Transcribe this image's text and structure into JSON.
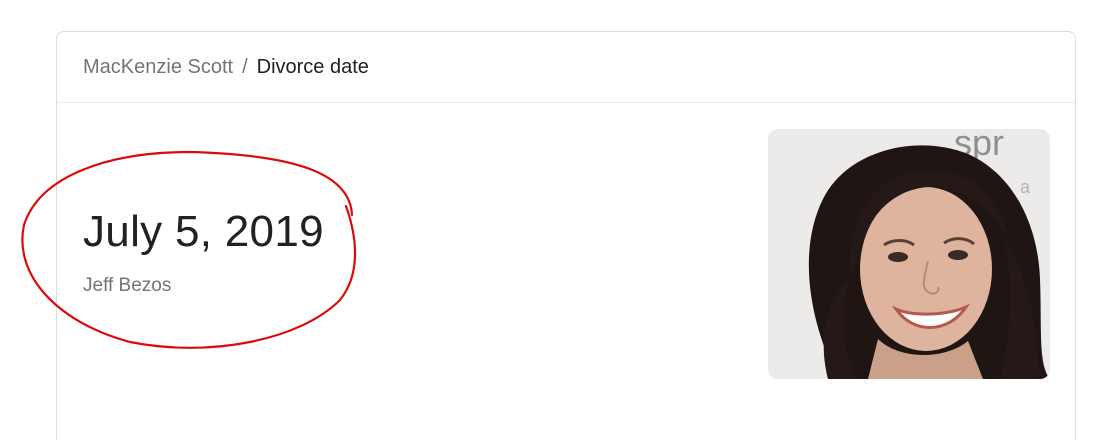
{
  "breadcrumb": {
    "parent": "MacKenzie Scott",
    "separator": "/",
    "current": "Divorce date"
  },
  "answer": {
    "date": "July 5, 2019",
    "subtitle": "Jeff Bezos"
  },
  "photo": {
    "backdrop_text": "spr",
    "backdrop_small": "a"
  },
  "colors": {
    "annotation": "#d90b0b",
    "muted_text": "#70757a",
    "main_text": "#202124",
    "border": "#dadce0"
  }
}
